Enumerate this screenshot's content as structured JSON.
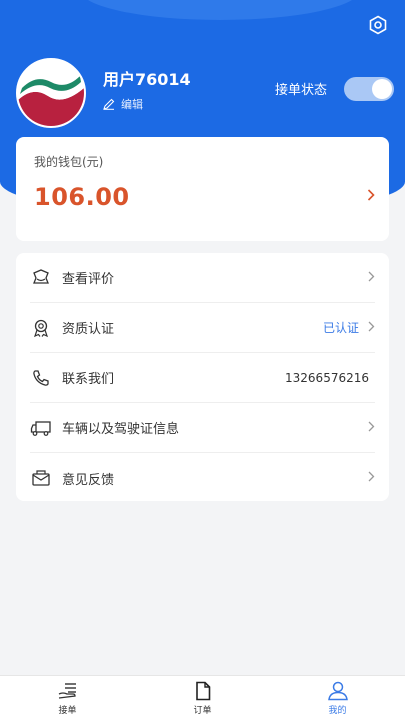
{
  "profile": {
    "username": "用户76014",
    "edit_label": "编辑",
    "status_label": "接单状态",
    "status_on": true
  },
  "wallet": {
    "title": "我的钱包(元)",
    "amount": "106.00"
  },
  "menu": [
    {
      "icon": "review-icon",
      "label": "查看评价",
      "value": ""
    },
    {
      "icon": "certificate-icon",
      "label": "资质认证",
      "value": "已认证"
    },
    {
      "icon": "phone-icon",
      "label": "联系我们",
      "value": "13266576216"
    },
    {
      "icon": "truck-icon",
      "label": "车辆以及驾驶证信息",
      "value": ""
    },
    {
      "icon": "feedback-icon",
      "label": "意见反馈",
      "value": ""
    }
  ],
  "tabs": [
    {
      "icon": "take-order-icon",
      "label": "接单"
    },
    {
      "icon": "order-icon",
      "label": "订单"
    },
    {
      "icon": "profile-icon",
      "label": "我的"
    }
  ],
  "colors": {
    "brand_blue": "#1c6ae4",
    "amount_orange": "#d9542b",
    "active_tab": "#3b7be6"
  }
}
